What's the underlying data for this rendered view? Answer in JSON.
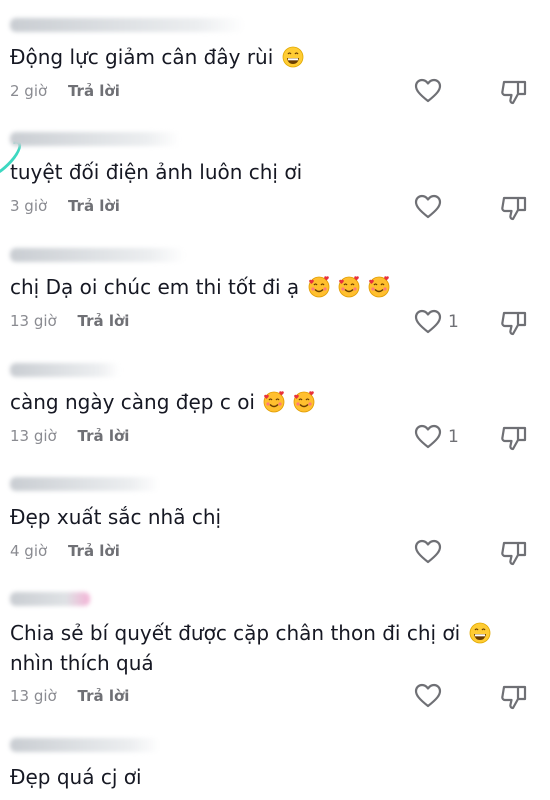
{
  "reply_label": "Trả lời",
  "colors": {
    "text": "#161823",
    "meta": "#8a8b91",
    "accent": "#3dd8c1"
  },
  "comments": [
    {
      "text": "Động lực giảm cân đây rùi",
      "emojis": [
        "grinning-face"
      ],
      "time": "2 giờ",
      "like_count": ""
    },
    {
      "text": "tuyệt đối điện ảnh luôn chị ơi",
      "emojis": [],
      "time": "3 giờ",
      "like_count": ""
    },
    {
      "text": "chị Dạ oi chúc em thi tốt đi ạ",
      "emojis": [
        "smiling-face-with-hearts",
        "smiling-face-with-hearts",
        "smiling-face-with-hearts"
      ],
      "time": "13 giờ",
      "like_count": "1"
    },
    {
      "text": "càng ngày càng đẹp c oi",
      "emojis": [
        "smiling-face-with-hearts",
        "smiling-face-with-hearts"
      ],
      "time": "13 giờ",
      "like_count": "1"
    },
    {
      "text": "Đẹp xuất sắc nhã chị",
      "emojis": [],
      "time": "4 giờ",
      "like_count": ""
    },
    {
      "text": "Chia sẻ bí quyết được cặp chân thon đi chị ơi",
      "text_line2": "nhìn thích quá",
      "emojis": [
        "grinning-face"
      ],
      "time": "13 giờ",
      "like_count": ""
    },
    {
      "text": "Đẹp quá cj ơi",
      "emojis": [],
      "time": "",
      "like_count": ""
    }
  ]
}
